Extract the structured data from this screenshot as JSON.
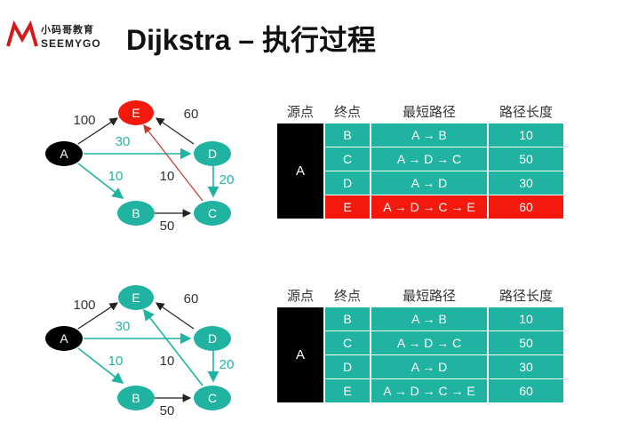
{
  "logo": {
    "cn": "小码哥教育",
    "en": "SEEMYGO"
  },
  "title": "Dijkstra – 执行过程",
  "colors": {
    "teal": "#21b3a2",
    "red": "#f5180d",
    "black": "#000000"
  },
  "graph": {
    "nodes": [
      "A",
      "B",
      "C",
      "D",
      "E"
    ],
    "edge_labels": {
      "AE": "100",
      "AD": "30",
      "AB": "10",
      "BC": "50",
      "DC": "20",
      "DE": "60",
      "CE": "10"
    }
  },
  "table": {
    "headers": [
      "源点",
      "终点",
      "最短路径",
      "路径长度"
    ],
    "source": "A",
    "rows": [
      {
        "end": "B",
        "path": "A → B",
        "len": "10"
      },
      {
        "end": "C",
        "path": "A → D → C",
        "len": "50"
      },
      {
        "end": "D",
        "path": "A → D",
        "len": "30"
      },
      {
        "end": "E",
        "path": "A → D → C → E",
        "len": "60"
      }
    ]
  }
}
